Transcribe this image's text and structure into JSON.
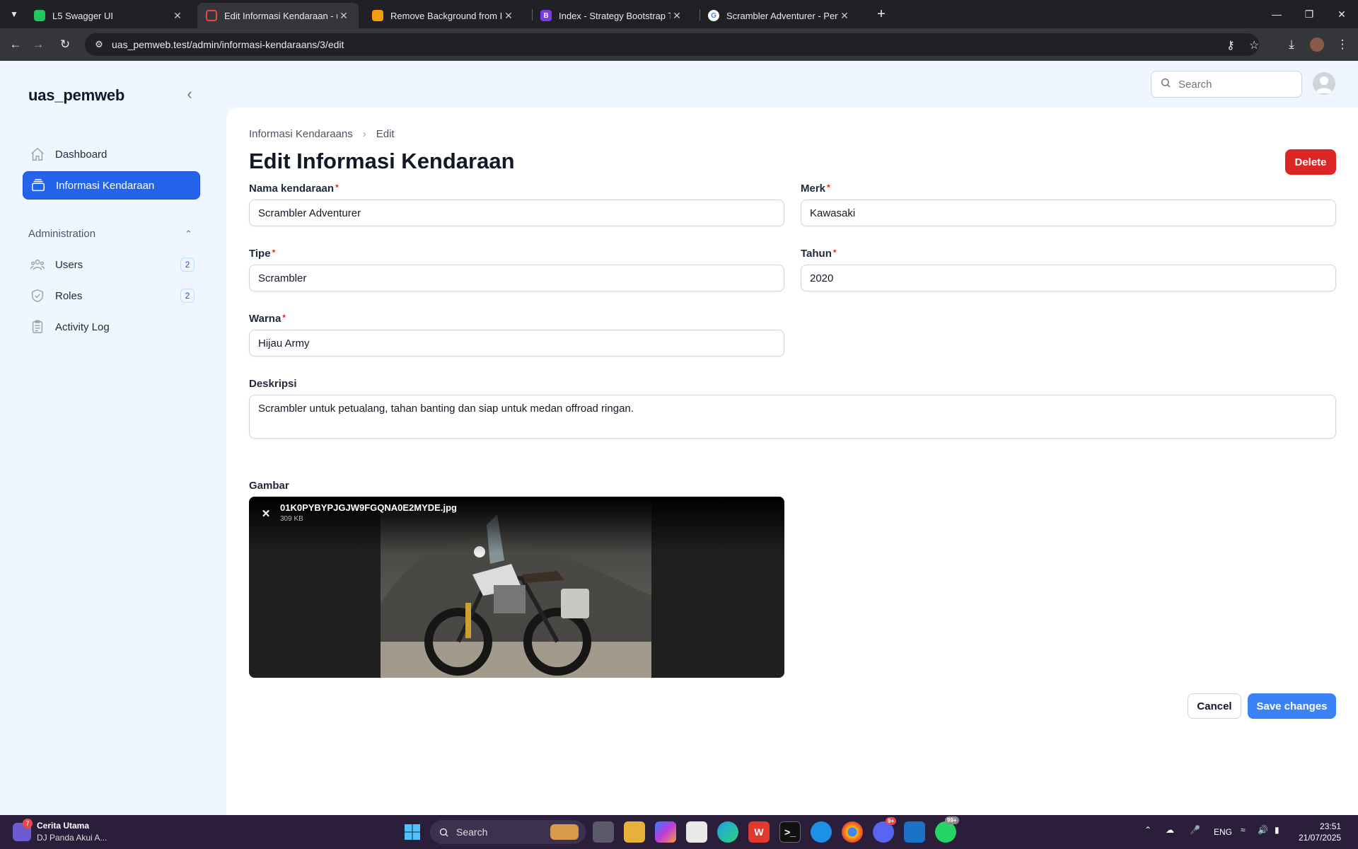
{
  "browser": {
    "tabs": [
      {
        "title": "L5 Swagger UI",
        "color": "#22c55e",
        "letter": ""
      },
      {
        "title": "Edit Informasi Kendaraan - uas_",
        "color": "#ef4444",
        "letter": ""
      },
      {
        "title": "Remove Background from Imag",
        "color": "#f59e0b",
        "letter": ""
      },
      {
        "title": "Index - Strategy Bootstrap Temp",
        "color": "#7c3aed",
        "letter": "B"
      },
      {
        "title": "Scrambler Adventurer - Penelus",
        "color": "#ffffff",
        "letter": "G"
      }
    ],
    "url": "uas_pemweb.test/admin/informasi-kendaraans/3/edit"
  },
  "sidebar": {
    "brand": "uas_pemweb",
    "items": [
      {
        "label": "Dashboard"
      },
      {
        "label": "Informasi Kendaraan"
      }
    ],
    "group": {
      "label": "Administration",
      "items": [
        {
          "label": "Users",
          "badge": "2"
        },
        {
          "label": "Roles",
          "badge": "2"
        },
        {
          "label": "Activity Log",
          "badge": ""
        }
      ]
    }
  },
  "topbar": {
    "search_placeholder": "Search"
  },
  "page": {
    "breadcrumb": [
      "Informasi Kendaraans",
      "Edit"
    ],
    "title": "Edit Informasi Kendaraan",
    "delete_label": "Delete",
    "cancel_label": "Cancel",
    "save_label": "Save changes"
  },
  "form": {
    "nama": {
      "label": "Nama kendaraan",
      "value": "Scrambler Adventurer",
      "required": "*"
    },
    "merk": {
      "label": "Merk",
      "value": "Kawasaki",
      "required": "*"
    },
    "tipe": {
      "label": "Tipe",
      "value": "Scrambler",
      "required": "*"
    },
    "tahun": {
      "label": "Tahun",
      "value": "2020",
      "required": "*"
    },
    "warna": {
      "label": "Warna",
      "value": "Hijau Army",
      "required": "*"
    },
    "deskripsi": {
      "label": "Deskripsi",
      "value": "Scrambler untuk petualang, tahan banting dan siap untuk medan offroad ringan."
    },
    "gambar": {
      "label": "Gambar",
      "filename": "01K0PYBYPJGJW9FGQNA0E2MYDE.jpg",
      "filesize": "309 KB"
    }
  },
  "taskbar": {
    "news_title": "Cerita Utama",
    "news_sub": "DJ Panda Akui A...",
    "news_badge": "7",
    "search": "Search",
    "lang": "ENG",
    "time": "23:51",
    "date": "21/07/2025",
    "discord_badge": "9+",
    "whatsapp_badge": "99+"
  },
  "colors": {
    "accent": "#2563eb",
    "danger": "#dc2626",
    "primary_button": "#3b82f6",
    "app_bg": "#eff6ff"
  }
}
